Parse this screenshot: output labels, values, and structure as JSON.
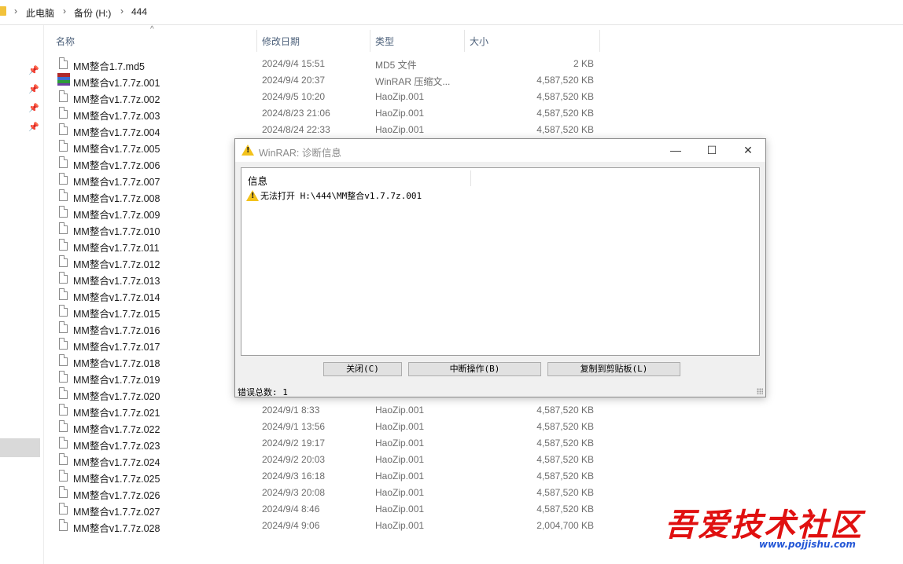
{
  "breadcrumb": {
    "items": [
      "此电脑",
      "备份 (H:)",
      "444"
    ],
    "separator": "›"
  },
  "columns": {
    "name": "名称",
    "date": "修改日期",
    "type": "类型",
    "size": "大小"
  },
  "files": [
    {
      "name": "MM整合1.7.md5",
      "date": "2024/9/4 15:51",
      "type": "MD5 文件",
      "size": "2 KB",
      "icon": "file-icon"
    },
    {
      "name": "MM整合v1.7.7z.001",
      "date": "2024/9/4 20:37",
      "type": "WinRAR 压缩文...",
      "size": "4,587,520 KB",
      "icon": "winrar-icon"
    },
    {
      "name": "MM整合v1.7.7z.002",
      "date": "2024/9/5 10:20",
      "type": "HaoZip.001",
      "size": "4,587,520 KB",
      "icon": "file-icon"
    },
    {
      "name": "MM整合v1.7.7z.003",
      "date": "2024/8/23 21:06",
      "type": "HaoZip.001",
      "size": "4,587,520 KB",
      "icon": "file-icon"
    },
    {
      "name": "MM整合v1.7.7z.004",
      "date": "2024/8/24 22:33",
      "type": "HaoZip.001",
      "size": "4,587,520 KB",
      "icon": "file-icon"
    },
    {
      "name": "MM整合v1.7.7z.005",
      "date": "",
      "type": "",
      "size": "",
      "icon": "file-icon"
    },
    {
      "name": "MM整合v1.7.7z.006",
      "date": "",
      "type": "",
      "size": "",
      "icon": "file-icon"
    },
    {
      "name": "MM整合v1.7.7z.007",
      "date": "",
      "type": "",
      "size": "",
      "icon": "file-icon"
    },
    {
      "name": "MM整合v1.7.7z.008",
      "date": "",
      "type": "",
      "size": "",
      "icon": "file-icon"
    },
    {
      "name": "MM整合v1.7.7z.009",
      "date": "",
      "type": "",
      "size": "",
      "icon": "file-icon"
    },
    {
      "name": "MM整合v1.7.7z.010",
      "date": "",
      "type": "",
      "size": "",
      "icon": "file-icon"
    },
    {
      "name": "MM整合v1.7.7z.011",
      "date": "",
      "type": "",
      "size": "",
      "icon": "file-icon"
    },
    {
      "name": "MM整合v1.7.7z.012",
      "date": "",
      "type": "",
      "size": "",
      "icon": "file-icon"
    },
    {
      "name": "MM整合v1.7.7z.013",
      "date": "",
      "type": "",
      "size": "",
      "icon": "file-icon"
    },
    {
      "name": "MM整合v1.7.7z.014",
      "date": "",
      "type": "",
      "size": "",
      "icon": "file-icon"
    },
    {
      "name": "MM整合v1.7.7z.015",
      "date": "",
      "type": "",
      "size": "",
      "icon": "file-icon"
    },
    {
      "name": "MM整合v1.7.7z.016",
      "date": "",
      "type": "",
      "size": "",
      "icon": "file-icon"
    },
    {
      "name": "MM整合v1.7.7z.017",
      "date": "",
      "type": "",
      "size": "",
      "icon": "file-icon"
    },
    {
      "name": "MM整合v1.7.7z.018",
      "date": "",
      "type": "",
      "size": "",
      "icon": "file-icon"
    },
    {
      "name": "MM整合v1.7.7z.019",
      "date": "",
      "type": "",
      "size": "",
      "icon": "file-icon"
    },
    {
      "name": "MM整合v1.7.7z.020",
      "date": "",
      "type": "",
      "size": "",
      "icon": "file-icon"
    },
    {
      "name": "MM整合v1.7.7z.021",
      "date": "2024/9/1 8:33",
      "type": "HaoZip.001",
      "size": "4,587,520 KB",
      "icon": "file-icon"
    },
    {
      "name": "MM整合v1.7.7z.022",
      "date": "2024/9/1 13:56",
      "type": "HaoZip.001",
      "size": "4,587,520 KB",
      "icon": "file-icon"
    },
    {
      "name": "MM整合v1.7.7z.023",
      "date": "2024/9/2 19:17",
      "type": "HaoZip.001",
      "size": "4,587,520 KB",
      "icon": "file-icon"
    },
    {
      "name": "MM整合v1.7.7z.024",
      "date": "2024/9/2 20:03",
      "type": "HaoZip.001",
      "size": "4,587,520 KB",
      "icon": "file-icon"
    },
    {
      "name": "MM整合v1.7.7z.025",
      "date": "2024/9/3 16:18",
      "type": "HaoZip.001",
      "size": "4,587,520 KB",
      "icon": "file-icon"
    },
    {
      "name": "MM整合v1.7.7z.026",
      "date": "2024/9/3 20:08",
      "type": "HaoZip.001",
      "size": "4,587,520 KB",
      "icon": "file-icon"
    },
    {
      "name": "MM整合v1.7.7z.027",
      "date": "2024/9/4 8:46",
      "type": "HaoZip.001",
      "size": "4,587,520 KB",
      "icon": "file-icon"
    },
    {
      "name": "MM整合v1.7.7z.028",
      "date": "2024/9/4 9:06",
      "type": "HaoZip.001",
      "size": "2,004,700 KB",
      "icon": "file-icon"
    }
  ],
  "dialog": {
    "title": "WinRAR: 诊断信息",
    "list_header": "信息",
    "message": "无法打开 H:\\444\\MM整合v1.7.7z.001",
    "buttons": {
      "close": "关闭(C)",
      "abort": "中断操作(B)",
      "copy": "复制到剪贴板(L)"
    },
    "status": "错误总数: 1",
    "window_controls": {
      "minimize": "—",
      "maximize": "☐",
      "close": "✕"
    }
  },
  "watermark": {
    "text": "吾爱技术社区",
    "url": "www.pojjishu.com"
  },
  "colors": {
    "header_text": "#4c607a",
    "secondary_text": "#6d6d6d",
    "warning": "#f3c21b",
    "watermark_red": "#e01010",
    "watermark_blue": "#2457d6"
  }
}
